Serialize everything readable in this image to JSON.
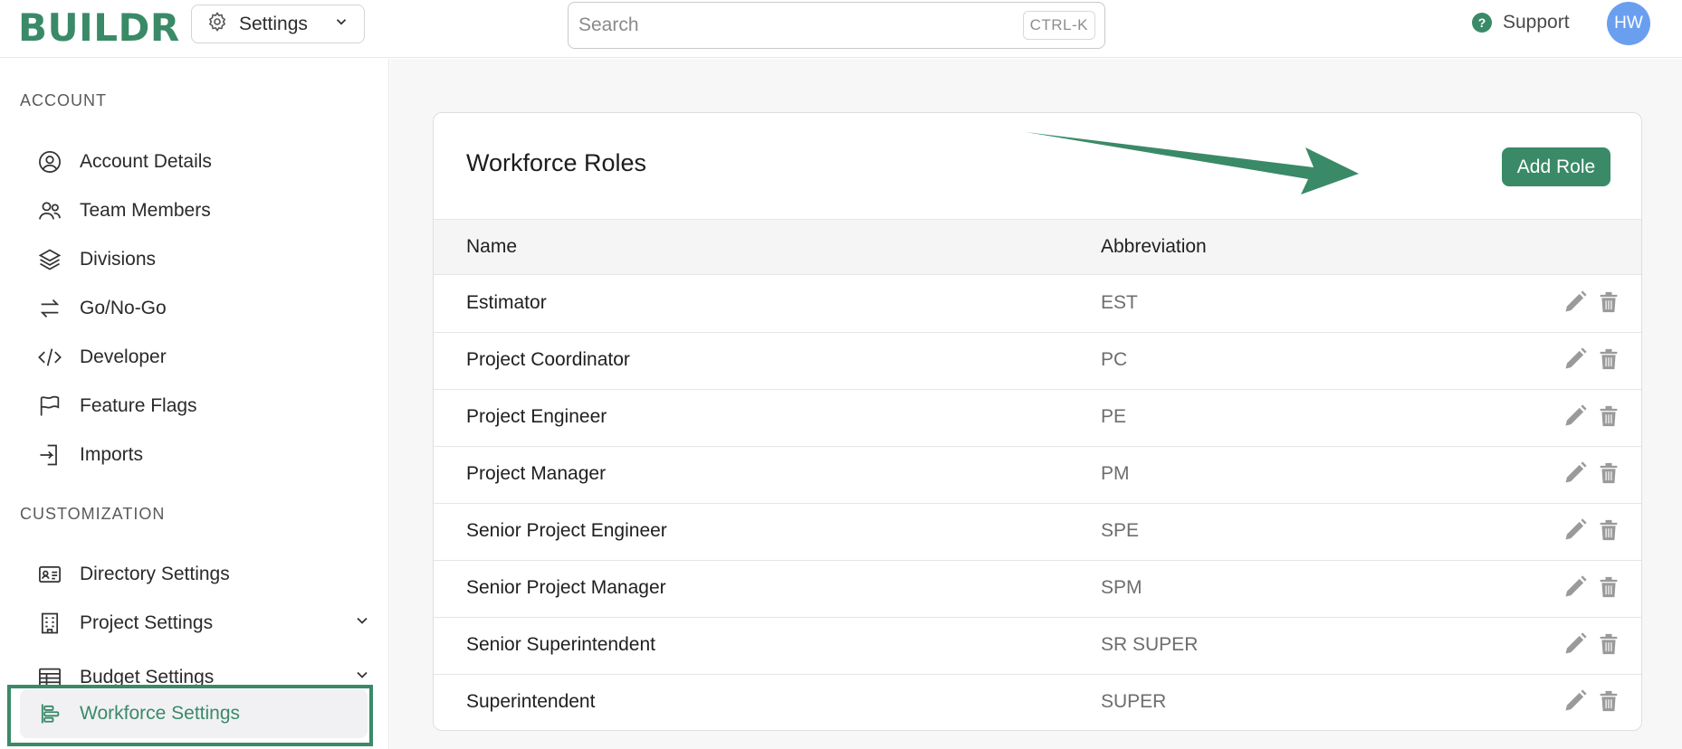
{
  "app": {
    "logo": "BUILDR"
  },
  "header": {
    "settings_label": "Settings",
    "search_placeholder": "Search",
    "search_shortcut": "CTRL-K",
    "support_label": "Support",
    "avatar_initials": "HW"
  },
  "sidebar": {
    "account_label": "ACCOUNT",
    "account_items": [
      {
        "label": "Account Details",
        "icon": "user-circle-icon"
      },
      {
        "label": "Team Members",
        "icon": "users-icon"
      },
      {
        "label": "Divisions",
        "icon": "layers-icon"
      },
      {
        "label": "Go/No-Go",
        "icon": "arrows-right-left-icon"
      },
      {
        "label": "Developer",
        "icon": "code-icon"
      },
      {
        "label": "Feature Flags",
        "icon": "flag-icon"
      },
      {
        "label": "Imports",
        "icon": "import-icon"
      }
    ],
    "customization_label": "CUSTOMIZATION",
    "customization_items": [
      {
        "label": "Directory Settings",
        "icon": "id-card-icon"
      },
      {
        "label": "Project Settings",
        "icon": "building-icon"
      },
      {
        "label": "Budget Settings",
        "icon": "table-icon"
      },
      {
        "label": "Workforce Settings",
        "icon": "bars-staggered-icon",
        "active": true
      }
    ]
  },
  "main": {
    "title": "Workforce Roles",
    "add_button": "Add Role",
    "columns": [
      "Name",
      "Abbreviation"
    ],
    "rows": [
      {
        "name": "Estimator",
        "abbr": "EST"
      },
      {
        "name": "Project Coordinator",
        "abbr": "PC"
      },
      {
        "name": "Project Engineer",
        "abbr": "PE"
      },
      {
        "name": "Project Manager",
        "abbr": "PM"
      },
      {
        "name": "Senior Project Engineer",
        "abbr": "SPE"
      },
      {
        "name": "Senior Project Manager",
        "abbr": "SPM"
      },
      {
        "name": "Senior Superintendent",
        "abbr": "SR SUPER"
      },
      {
        "name": "Superintendent",
        "abbr": "SUPER"
      }
    ]
  },
  "colors": {
    "brand": "#3a8a68",
    "avatar": "#6a9ff0",
    "icon_gray": "#9a9a9a"
  }
}
